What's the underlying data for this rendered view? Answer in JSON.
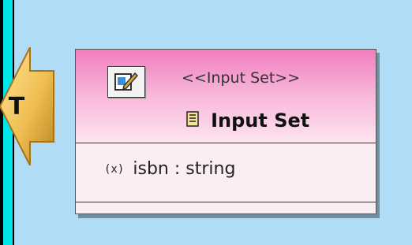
{
  "element": {
    "stereotype": "<<Input Set>>",
    "title": "Input Set",
    "attribute": "isbn : string"
  },
  "connector": {
    "letter": "T"
  },
  "icons": {
    "edit": "edit-pencil-icon",
    "title": "document-icon",
    "attribute": "variable-x-icon"
  },
  "colors": {
    "background": "#b0dcf5",
    "header_top": "#f17dbd",
    "header_bottom": "#fde4f0",
    "body": "#fbeef2",
    "left_stripe": "#00e5ea",
    "connector": "#f3c45a"
  }
}
